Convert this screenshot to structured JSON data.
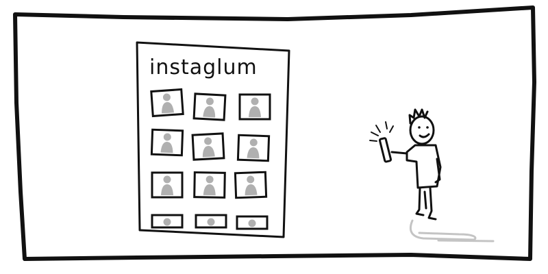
{
  "comic": {
    "building_sign": "instaglum",
    "photo_rows": 4,
    "photo_cols": 3,
    "colors": {
      "ink": "#111111",
      "panel_bg": "#ffffff",
      "photo_gray": "#b0b0b0",
      "shadow_gray": "#c4c4c4"
    }
  }
}
